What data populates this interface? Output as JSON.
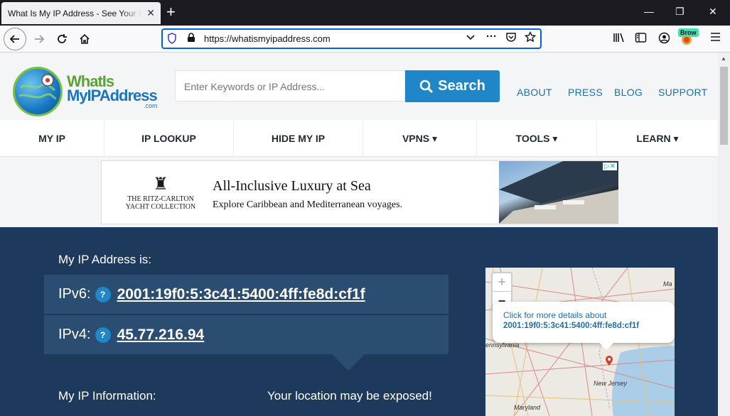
{
  "browser": {
    "tab_title": "What Is My IP Address - See Your Public Address",
    "tab_close": "✕",
    "new_tab": "+",
    "minimize": "—",
    "restore": "❐",
    "close": "✕",
    "url": "https://whatismyipaddress.com",
    "extension_badge": "Brow"
  },
  "site": {
    "logo_line1": "WhatIs",
    "logo_line2": "MyIPAddress",
    "logo_line3": ".com",
    "search_placeholder": "Enter Keywords or IP Address...",
    "search_button": "Search",
    "top_links": [
      "ABOUT",
      "PRESS",
      "BLOG",
      "SUPPORT"
    ],
    "menu": [
      "MY IP",
      "IP LOOKUP",
      "HIDE MY IP",
      "VPNS ▾",
      "TOOLS ▾",
      "LEARN ▾"
    ]
  },
  "ad": {
    "brand_line1": "THE RITZ-CARLTON",
    "brand_line2": "YACHT COLLECTION",
    "title": "All-Inclusive Luxury at Sea",
    "subtitle": "Explore Caribbean and Mediterranean voyages.",
    "badge": "▷✕"
  },
  "ip": {
    "heading": "My IP Address is:",
    "ipv6_label": "IPv6:",
    "ipv6_value": "2001:19f0:5:3c41:5400:4ff:fe8d:cf1f",
    "ipv4_label": "IPv4:",
    "ipv4_value": "45.77.216.94",
    "help": "?",
    "info_heading": "My IP Information:",
    "exposed_text": "Your location may be exposed!"
  },
  "map": {
    "zoom_in": "+",
    "zoom_out": "−",
    "popup_line1": "Click for more details about",
    "popup_line2": "2001:19f0:5:3c41:5400:4ff:fe8d:cf1f",
    "label_pennsylvania": "ennsylvania",
    "label_newjersey": "New Jersey",
    "label_maryland": "Maryland",
    "label_ma": "Ma"
  }
}
